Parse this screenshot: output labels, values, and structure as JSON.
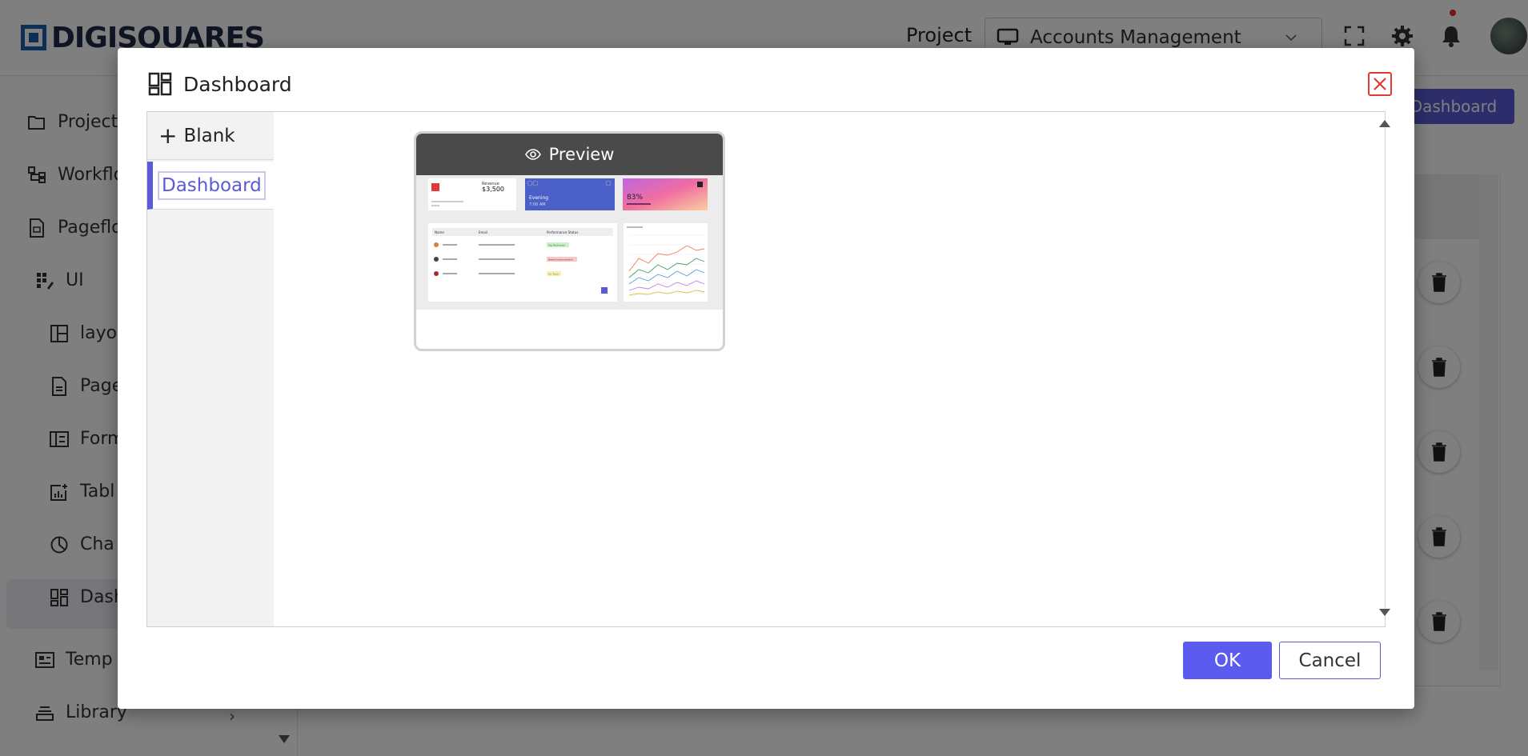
{
  "app": {
    "brand": "DIGISQUARES",
    "project_label": "Project",
    "project_value": "Accounts Management"
  },
  "sidebar": {
    "items": [
      {
        "label": "Project",
        "icon": "folder-icon"
      },
      {
        "label": "Workflo",
        "icon": "workflow-icon"
      },
      {
        "label": "Pageflo",
        "icon": "pageflow-icon"
      },
      {
        "label": "UI",
        "icon": "ui-icon"
      },
      {
        "label": "layo",
        "icon": "layout-icon"
      },
      {
        "label": "Page",
        "icon": "page-icon"
      },
      {
        "label": "Form",
        "icon": "form-icon"
      },
      {
        "label": "Tabl",
        "icon": "table-icon"
      },
      {
        "label": "Cha",
        "icon": "chart-icon"
      },
      {
        "label": "Dash",
        "icon": "dashboard-icon"
      },
      {
        "label": "Temp",
        "icon": "template-icon"
      },
      {
        "label": "Library",
        "icon": "library-icon"
      }
    ],
    "library_arrow": "›"
  },
  "main": {
    "add_button_label": "Dashboard"
  },
  "modal": {
    "title": "Dashboard",
    "templates": [
      {
        "label": "Blank"
      },
      {
        "label": "Dashboard"
      }
    ],
    "preview_label": "Preview",
    "ok_label": "OK",
    "cancel_label": "Cancel"
  },
  "thumbnail": {
    "card1_label": "Revenue",
    "card1_value": "$3,500",
    "card2_value": "Evening",
    "card2_sub": "7:00 AM",
    "card3_value": "83%",
    "table_headers": [
      "Name",
      "Email",
      "Performance Status"
    ],
    "table_rows": [
      {
        "status": "Top Performer",
        "color": "#c9f0c9"
      },
      {
        "status": "Needs Improvement",
        "color": "#f6c8c8"
      },
      {
        "status": "On Track",
        "color": "#f5f0b8"
      }
    ]
  },
  "colors": {
    "accent": "#5b5bd6",
    "ok": "#5b5bf0",
    "close": "#e53935",
    "preview_bar": "#4a4a4a"
  }
}
